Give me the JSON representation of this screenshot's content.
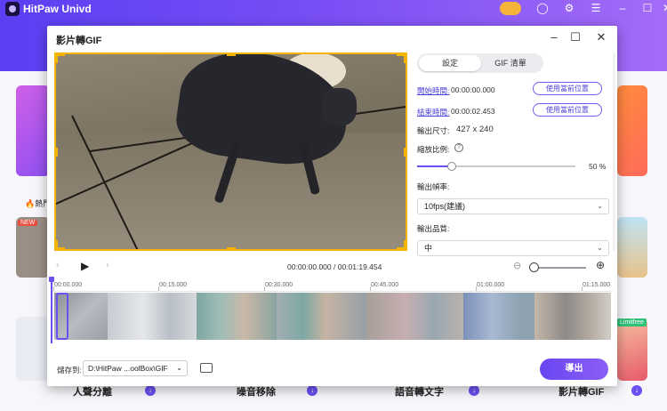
{
  "app": {
    "title": "HitPaw Univd",
    "hot_label": "熱門",
    "new_badge": "NEW",
    "limitfree_badge": "Limitfree",
    "bottom_tools": [
      "人聲分離",
      "噪音移除",
      "語音轉文字",
      "影片轉GIF"
    ]
  },
  "dialog": {
    "title": "影片轉GIF",
    "tabs": [
      "設定",
      "GIF 清單"
    ],
    "start_label": "開始時間:",
    "start_value": "00:00:00.000",
    "end_label": "結束時間:",
    "end_value": "00:00:02.453",
    "use_current_label": "使用當前位置",
    "size_label": "輸出尺寸:",
    "size_value": "427 x 240",
    "scale_label": "縮放比例:",
    "scale_value": "50 %",
    "scale_percent": 50,
    "framerate_label": "輸出幀率:",
    "framerate_value": "10fps(建議)",
    "quality_label": "輸出品質:",
    "quality_value": "中",
    "time_display": "00:00:00.000 / 00:01:19.454",
    "ruler": [
      "00:00.000",
      "00:15.000",
      "00:30.000",
      "00:45.000",
      "01:00.000",
      "01:15.000"
    ],
    "save_label": "儲存到:",
    "save_path": "D:\\HitPaw ...oolBox\\GIF",
    "export_label": "導出"
  }
}
